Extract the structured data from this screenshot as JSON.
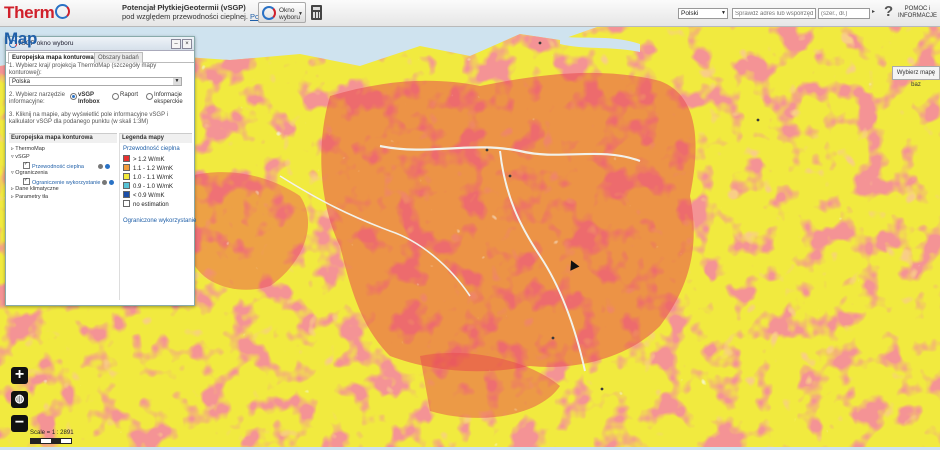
{
  "header": {
    "logo_thermo": "Therm",
    "logo_map": "Map",
    "subtitle_line1": "Potencjał PłytkiejGeotermii (vSGP)",
    "subtitle_line2": "pod względem przewodności cieplnej.",
    "show_intro_link": "Pokaż wstęp",
    "okno_line1": "Okno",
    "okno_line2": "wyboru",
    "language": "Polski",
    "address_placeholder": "Sprawdź adres lub współrzędne",
    "coord_placeholder": "(szer., dł.)",
    "help_line1": "POMOC i",
    "help_line2": "INFORMACJE"
  },
  "panel": {
    "title": "vSGP okno wyboru",
    "tabs": [
      "Europejska mapa konturowa",
      "Obszary badań"
    ],
    "step1": "1. Wybierz kraj/ projekcja ThermoMap (szczegóły mapy konturowej):",
    "country": "Polska",
    "step2": "2. Wybierz narzędzie informacyjne:",
    "tool_options": [
      {
        "label": "vSGP Infobox",
        "selected": true
      },
      {
        "label": "Raport",
        "selected": false
      },
      {
        "label": "Informacje eksperckie",
        "selected": false
      }
    ],
    "step3": "3. Kliknij na mapie, aby wyświetlić pole informacyjne vSGP i kalkulator vSGP dla podanego punktu (w skali 1:3M)",
    "left_title": "Europejska mapa konturowa",
    "tree": {
      "thermomap": "ThermoMap",
      "vsgp": "vSGP",
      "przewodnosc": "Przewodność cieplna",
      "ograniczenia": "Ograniczenia",
      "ograniczenia_wyk": "Ograniczenie wykorzystanie",
      "dane": "Dane klimatyczne",
      "parametry": "Parametry tła"
    },
    "right_title": "Legenda mapy",
    "legend_heading": "Przewodność cieplna",
    "legend": [
      {
        "label": "> 1.2 W/mK",
        "color": "#e8312f"
      },
      {
        "label": "1.1 - 1.2 W/mK",
        "color": "#f39c3a"
      },
      {
        "label": "1.0 - 1.1 W/mK",
        "color": "#f3ea3b"
      },
      {
        "label": "0.9 - 1.0 W/mK",
        "color": "#57c3d6"
      },
      {
        "label": "< 0.9 W/mK",
        "color": "#1c4fa8"
      },
      {
        "label": "no estimation",
        "color": "#ffffff"
      }
    ],
    "legend_link": "Ograniczone wykorzystanie"
  },
  "map": {
    "wybierz_label": "Wybierz mapę baz",
    "scale_text": "Scale = 1 : 2891",
    "zoom_in": "+",
    "zoom_out": "−"
  }
}
